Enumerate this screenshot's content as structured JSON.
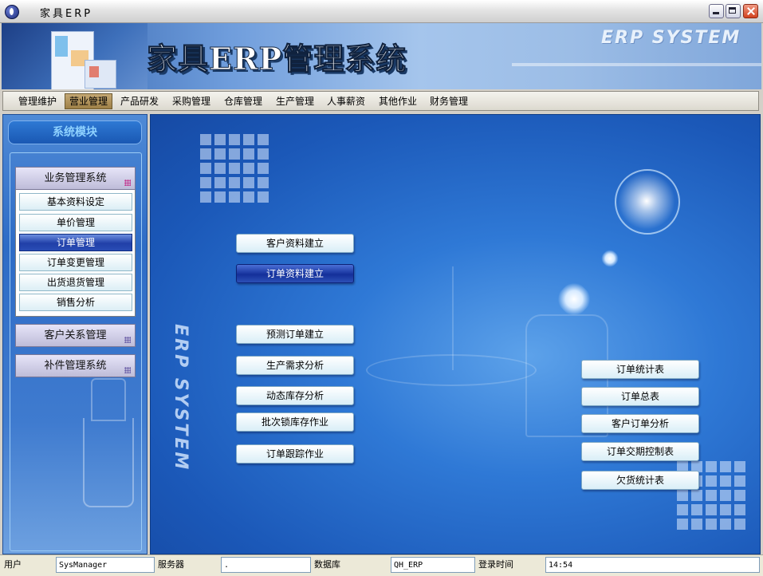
{
  "window": {
    "title": "家具ERP"
  },
  "banner": {
    "title": "家具ERP管理系统",
    "erp_text": "ERP SYSTEM"
  },
  "menu": {
    "items": [
      "管理维护",
      "营业管理",
      "产品研发",
      "采购管理",
      "仓库管理",
      "生产管理",
      "人事薪资",
      "其他作业",
      "财务管理"
    ],
    "active_index": 1
  },
  "sidebar": {
    "header": "系统模块",
    "groups": [
      {
        "label": "业务管理系统",
        "items": [
          "基本资料设定",
          "单价管理",
          "订单管理",
          "订单变更管理",
          "出货退货管理",
          "销售分析"
        ],
        "selected_index": 2
      },
      {
        "label": "客户关系管理"
      },
      {
        "label": "补件管理系统"
      }
    ]
  },
  "main": {
    "vertical_text": "ERP SYSTEM",
    "left_buttons": [
      "客户资料建立",
      "订单资料建立",
      "预测订单建立",
      "生产需求分析",
      "动态库存分析",
      "批次锁库存作业",
      "订单跟踪作业"
    ],
    "left_selected_index": 1,
    "right_buttons": [
      "订单统计表",
      "订单总表",
      "客户订单分析",
      "订单交期控制表",
      "欠货统计表"
    ]
  },
  "status": {
    "user_label": "用户",
    "user_value": "SysManager",
    "server_label": "服务器",
    "server_value": ".",
    "db_label": "数据库",
    "db_value": "QH_ERP",
    "login_label": "登录时间",
    "login_value": "14:54"
  },
  "colors": {
    "accent": "#2f79d6",
    "selected": "#203fa8",
    "menu_active": "#b09258"
  }
}
